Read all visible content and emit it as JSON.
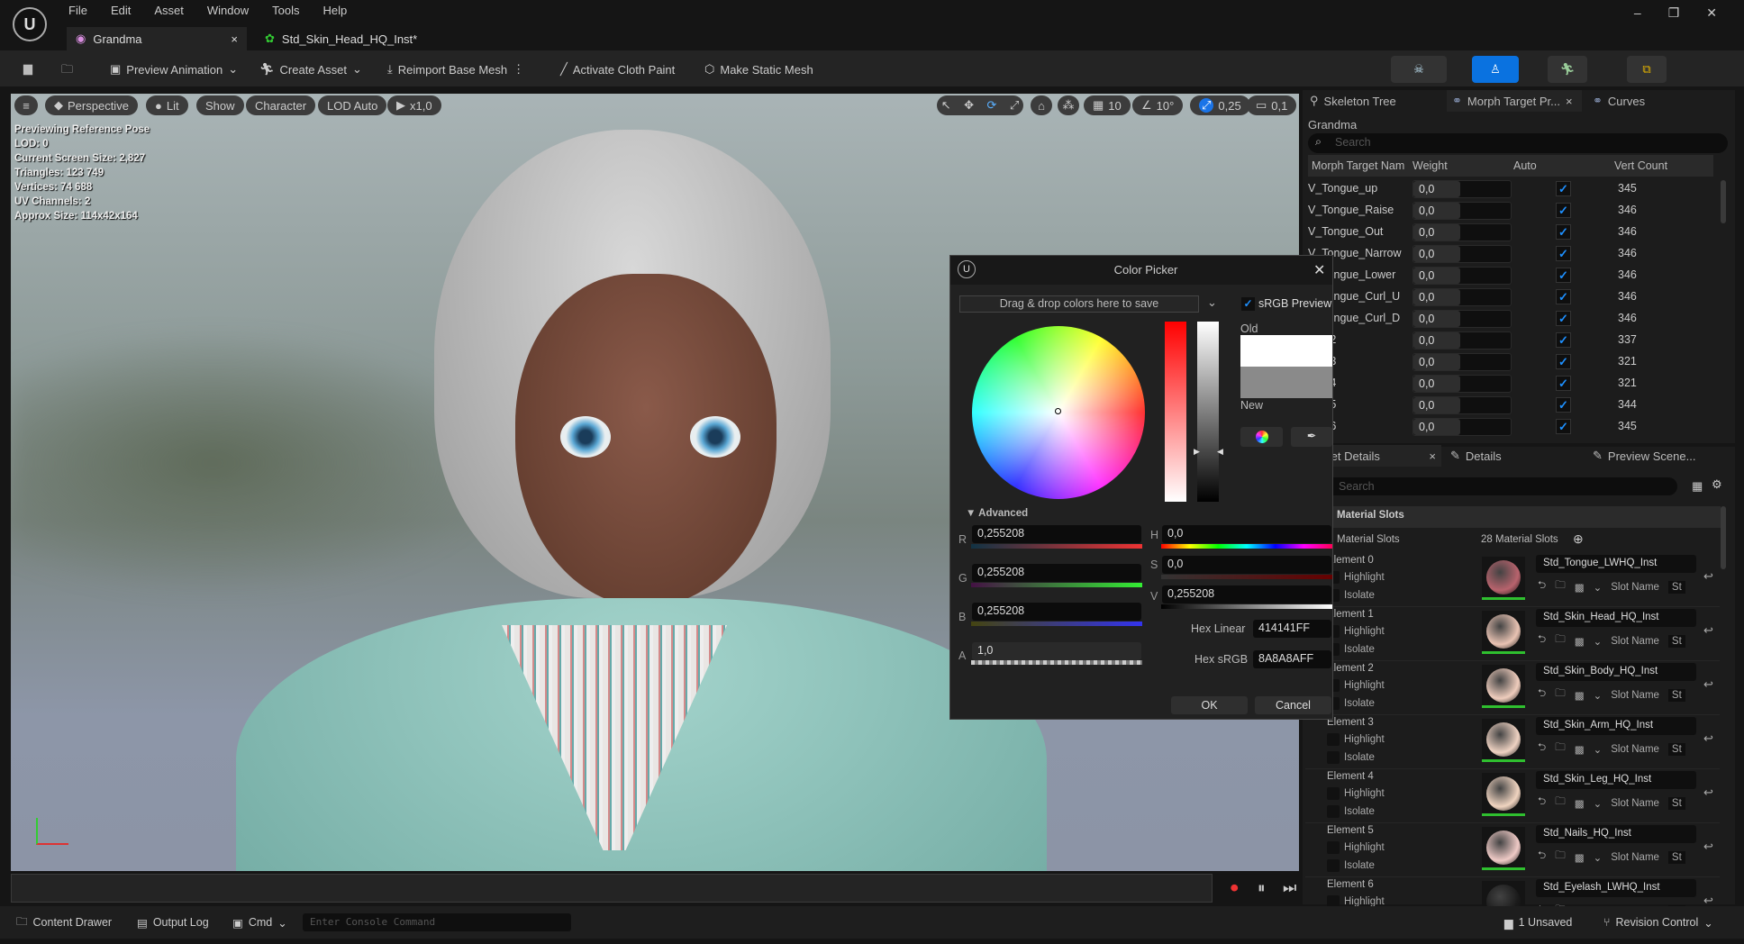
{
  "menu": [
    "File",
    "Edit",
    "Asset",
    "Window",
    "Tools",
    "Help"
  ],
  "tabs": [
    {
      "label": "Grandma",
      "close": "×"
    },
    {
      "label": "Std_Skin_Head_HQ_Inst*"
    }
  ],
  "toolbar": {
    "preview_animation": "Preview Animation",
    "create_asset": "Create Asset",
    "reimport": "Reimport Base Mesh",
    "cloth_paint": "Activate Cloth Paint",
    "static_mesh": "Make Static Mesh"
  },
  "viewport": {
    "pills": {
      "perspective": "Perspective",
      "lit": "Lit",
      "show": "Show",
      "character": "Character",
      "lod": "LOD Auto",
      "speed": "x1,0"
    },
    "right": {
      "grid": "10",
      "angle": "10°",
      "scale": "0,25",
      "camera": "0,1"
    },
    "info": [
      "Previewing Reference Pose",
      "LOD: 0",
      "Current Screen Size: 2,827",
      "Triangles: 123 749",
      "Vertices: 74 688",
      "UV Channels: 2",
      "Approx Size: 114x42x164"
    ]
  },
  "morph_panel": {
    "tabs": [
      "Skeleton Tree",
      "Morph Target Pr...",
      "Curves"
    ],
    "title": "Grandma",
    "search_placeholder": "Search",
    "columns": [
      "Morph Target Nam",
      "Weight",
      "Auto",
      "Vert Count"
    ],
    "rows": [
      {
        "name": "V_Tongue_up",
        "weight": "0,0",
        "count": "345"
      },
      {
        "name": "V_Tongue_Raise",
        "weight": "0,0",
        "count": "346"
      },
      {
        "name": "V_Tongue_Out",
        "weight": "0,0",
        "count": "346"
      },
      {
        "name": "V_Tongue_Narrow",
        "weight": "0,0",
        "count": "346"
      },
      {
        "name": "V_Tongue_Lower",
        "weight": "0,0",
        "count": "346"
      },
      {
        "name": "V_Tongue_Curl_U",
        "weight": "0,0",
        "count": "346"
      },
      {
        "name": "V_Tongue_Curl_D",
        "weight": "0,0",
        "count": "346"
      },
      {
        "name": "..._52",
        "weight": "0,0",
        "count": "337"
      },
      {
        "name": "..._53",
        "weight": "0,0",
        "count": "321"
      },
      {
        "name": "..._54",
        "weight": "0,0",
        "count": "321"
      },
      {
        "name": "..._55",
        "weight": "0,0",
        "count": "344"
      },
      {
        "name": "..._56",
        "weight": "0,0",
        "count": "345"
      }
    ]
  },
  "details_panel": {
    "tabs": [
      "Asset Details",
      "Details",
      "Preview Scene..."
    ],
    "search_placeholder": "Search",
    "section": "Material Slots",
    "slots_label": "Material Slots",
    "slots_count": "28 Material Slots",
    "highlight": "Highlight",
    "isolate": "Isolate",
    "slot_name": "Slot Name",
    "slot_value": "St",
    "elements": [
      {
        "label": "Element 0",
        "material": "Std_Tongue_LWHQ_Inst",
        "color": "#b8636d"
      },
      {
        "label": "Element 1",
        "material": "Std_Skin_Head_HQ_Inst",
        "color": "#e9c3b3"
      },
      {
        "label": "Element 2",
        "material": "Std_Skin_Body_HQ_Inst",
        "color": "#efcdbd"
      },
      {
        "label": "Element 3",
        "material": "Std_Skin_Arm_HQ_Inst",
        "color": "#efd2c2"
      },
      {
        "label": "Element 4",
        "material": "Std_Skin_Leg_HQ_Inst",
        "color": "#f0d4c0"
      },
      {
        "label": "Element 5",
        "material": "Std_Nails_HQ_Inst",
        "color": "#efcac6"
      },
      {
        "label": "Element 6",
        "material": "Std_Eyelash_LWHQ_Inst",
        "color": "#1a1a1a"
      }
    ]
  },
  "color_picker": {
    "title": "Color Picker",
    "drop_hint": "Drag & drop colors here to save",
    "srgb_preview": "sRGB Preview",
    "old": "Old",
    "new": "New",
    "old_color": "#ffffff",
    "new_color": "#8a8a8a",
    "advanced": "Advanced",
    "r": "0,255208",
    "g": "0,255208",
    "b": "0,255208",
    "a": "1,0",
    "h": "0,0",
    "s": "0,0",
    "v": "0,255208",
    "hex_linear_label": "Hex Linear",
    "hex_linear": "414141FF",
    "hex_srgb_label": "Hex sRGB",
    "hex_srgb": "8A8A8AFF",
    "ok": "OK",
    "cancel": "Cancel"
  },
  "status_bar": {
    "content_drawer": "Content Drawer",
    "output_log": "Output Log",
    "cmd": "Cmd",
    "console_placeholder": "Enter Console Command",
    "unsaved": "1 Unsaved",
    "revision_control": "Revision Control"
  }
}
